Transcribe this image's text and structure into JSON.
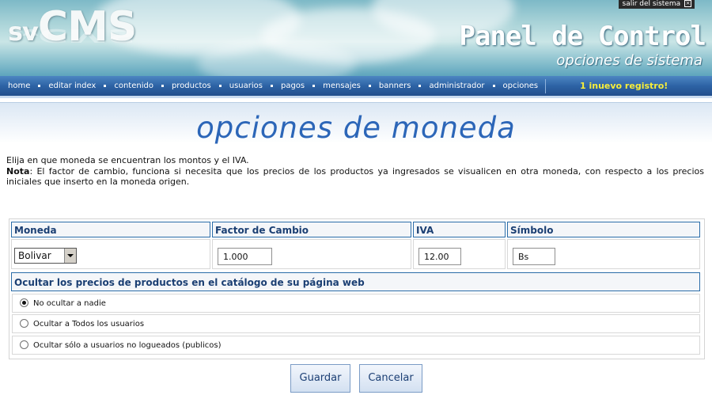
{
  "header": {
    "logo_sv": "sv",
    "logo_cms": "CMS",
    "title": "Panel de Control",
    "subtitle": "opciones de sistema",
    "logout_label": "salir del sistema",
    "logout_icon": "close-icon"
  },
  "nav": {
    "items": [
      "home",
      "editar index",
      "contenido",
      "productos",
      "usuarios",
      "pagos",
      "mensajes",
      "banners",
      "administrador",
      "opciones"
    ],
    "notice": "1 inuevo registro!"
  },
  "page": {
    "title": "opciones de moneda",
    "intro": "Elija en que moneda se encuentran los montos y el IVA.",
    "note_label": "Nota",
    "note_text": ": El factor de cambio, funciona si necesita que los precios de los productos ya ingresados se visualicen en otra moneda, con respecto a los precios iniciales que inserto en la moneda origen."
  },
  "form": {
    "headers": {
      "moneda": "Moneda",
      "factor": "Factor de Cambio",
      "iva": "IVA",
      "simbolo": "Símbolo"
    },
    "moneda_selected": "Bolivar",
    "factor_value": "1.000",
    "iva_value": "12.00",
    "simbolo_value": "Bs",
    "hide_header": "Ocultar los precios de productos en el catálogo de su página web",
    "options": [
      {
        "label": "No ocultar a nadie",
        "checked": true
      },
      {
        "label": "Ocultar a Todos los usuarios",
        "checked": false
      },
      {
        "label": "Ocultar sólo a usuarios no logueados (publicos)",
        "checked": false
      }
    ]
  },
  "buttons": {
    "save": "Guardar",
    "cancel": "Cancelar"
  },
  "colors": {
    "nav_blue": "#2d63a5",
    "notice_yellow": "#f7ee3a",
    "title_blue": "#2c66b8",
    "header_border": "#2a6ca8"
  }
}
